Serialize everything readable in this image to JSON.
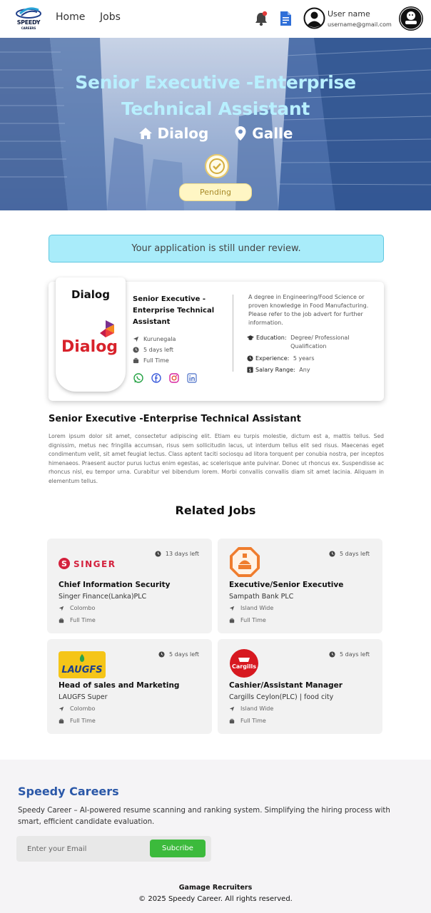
{
  "nav": {
    "brand_name": "SPEEDY",
    "brand_sub": "CAREERS",
    "links": [
      "Home",
      "Jobs"
    ],
    "user_name": "User name",
    "user_email": "username@gmail.com",
    "accent": "#2b58a8"
  },
  "hero": {
    "title": "Senior Executive -Enterprise Technical Assistant",
    "company": "Dialog",
    "location": "Galle",
    "status": "Pending"
  },
  "review_banner": "Your application is still under review.",
  "job_card": {
    "logo_name": "Dialog",
    "logo_text": "Dialog",
    "title": "Senior Executive - Enterprise  Technical Assistant",
    "location": "Kurunegala",
    "days_left": "5 days left",
    "type": "Full Time",
    "description": "A degree in Engineering/Food Science or proven knowledge in Food Manufacturing. Please refer to the job advert for further information.",
    "education_label": "Education:",
    "education_value": "Degree/ Professional Qualification",
    "experience_label": "Experience:",
    "experience_value": "5 years",
    "salary_label": "Salary Range:",
    "salary_value": "Any",
    "social_icons": [
      "whatsapp-icon",
      "facebook-icon",
      "instagram-icon",
      "linkedin-icon"
    ]
  },
  "description": {
    "title": "Senior Executive -Enterprise  Technical Assistant",
    "body": "Lorem ipsum dolor sit amet, consectetur adipiscing elit. Etiam eu turpis molestie, dictum est a, mattis tellus. Sed dignissim, metus nec fringilla accumsan, risus sem sollicitudin lacus, ut interdum tellus elit sed risus. Maecenas eget condimentum velit, sit amet feugiat lectus. Class aptent taciti sociosqu ad litora torquent per conubia nostra, per inceptos himenaeos. Praesent auctor purus luctus enim egestas, ac scelerisque ante pulvinar. Donec ut rhoncus ex. Suspendisse ac rhoncus nisl, eu tempor urna. Curabitur vel bibendum lorem. Morbi convallis convallis diam sit amet lacinia. Aliquam in elementum tellus."
  },
  "related": {
    "title": "Related Jobs",
    "jobs": [
      {
        "logo": "SINGER",
        "days": "13 days left",
        "title": "Chief Information Security",
        "company": "Singer Finance(Lanka)PLC",
        "location": "Colombo",
        "type": "Full Time"
      },
      {
        "logo": "Sampath Bank",
        "days": "5 days left",
        "title": "Executive/Senior Executive",
        "company": "Sampath Bank PLC",
        "location": "Island Wide",
        "type": "Full Time"
      },
      {
        "logo": "LAUGFS",
        "days": "5 days left",
        "title": "Head of sales and Marketing",
        "company": "LAUGFS Super",
        "location": "Colombo",
        "type": "Full Time"
      },
      {
        "logo": "Cargills",
        "days": "5 days left",
        "title": "Cashier/Assistant Manager",
        "company": "Cargills Ceylon(PLC) | food city",
        "location": "Island Wide",
        "type": "Full Time"
      }
    ]
  },
  "footer": {
    "brand": "Speedy Careers",
    "text": "Speedy Career – AI-powered resume scanning and ranking system. Simplifying the hiring process with smart, efficient candidate evaluation.",
    "email_placeholder": "Enter your Email",
    "subscribe_label": "Subcribe",
    "org": "Gamage Recruiters",
    "copyright": "© 2025 Speedy Career. All rights reserved."
  }
}
